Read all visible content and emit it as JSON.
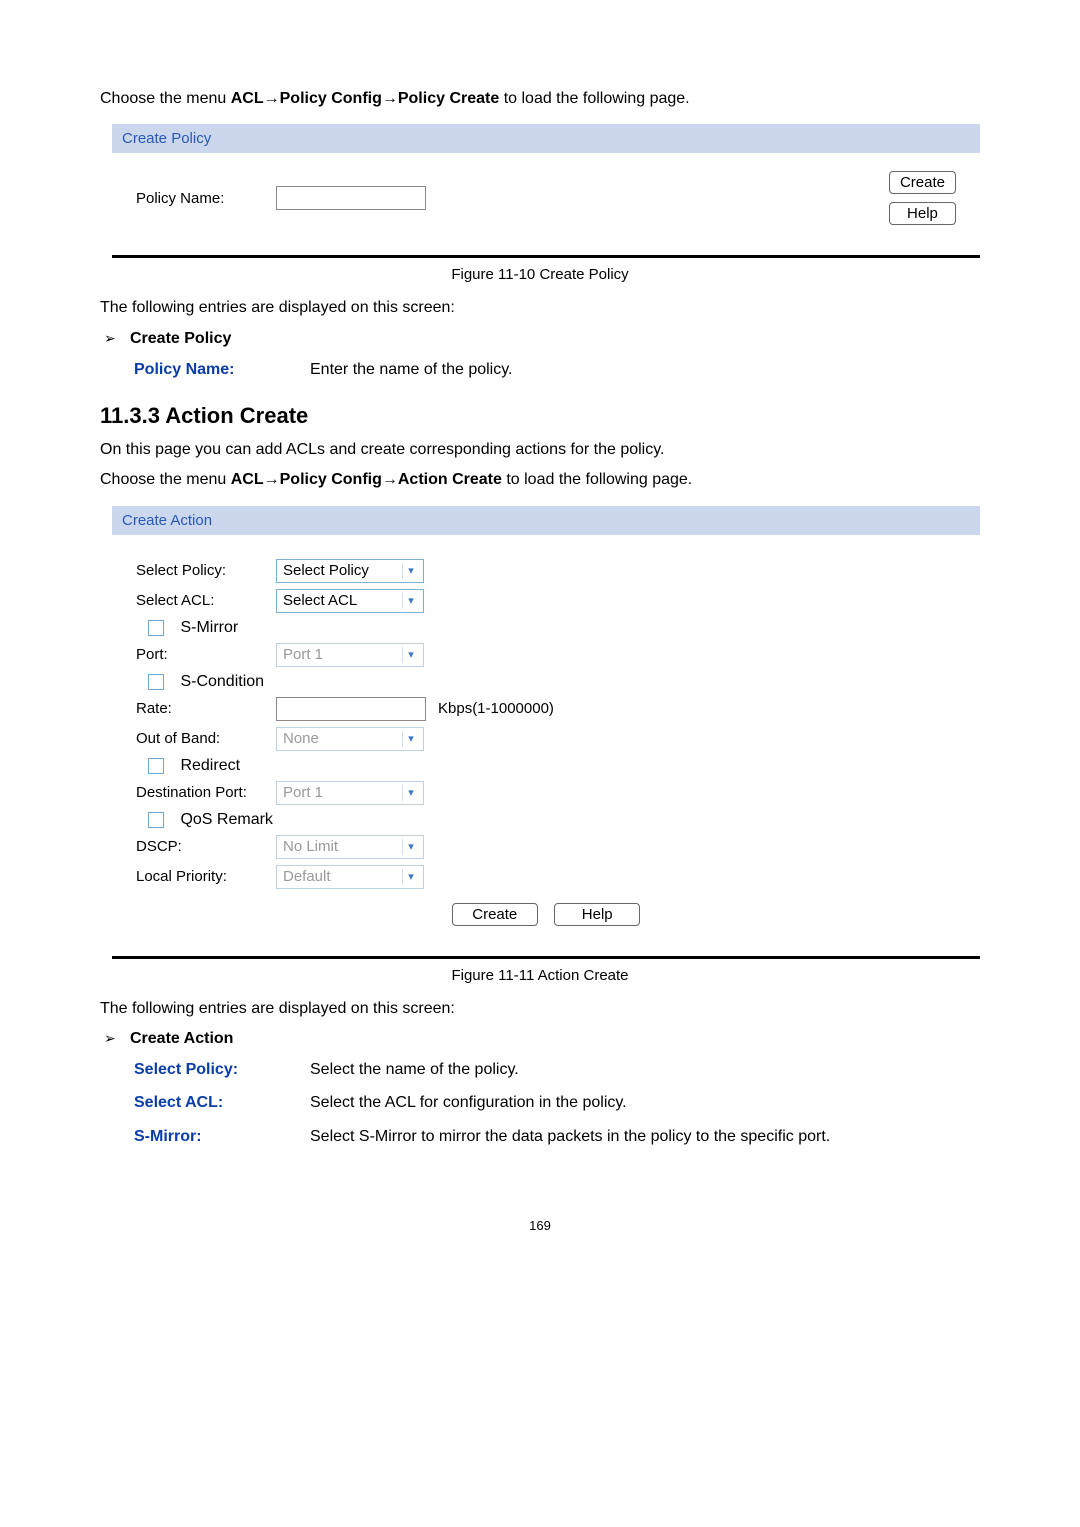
{
  "intro1_pre": "Choose the menu ",
  "intro1_path": "ACL→Policy Config→Policy Create",
  "intro1_post": " to load the following page.",
  "panel1": {
    "title": "Create Policy",
    "label": "Policy Name:",
    "btn_create": "Create",
    "btn_help": "Help"
  },
  "fig1": "Figure 11-10 Create Policy",
  "entries_text": "The following entries are displayed on this screen:",
  "bullet1": "Create Policy",
  "def1": {
    "term": "Policy Name:",
    "desc": "Enter the name of the policy."
  },
  "section_heading": "11.3.3  Action Create",
  "action_intro": "On this page you can add ACLs and create corresponding actions for the policy.",
  "intro2_pre": "Choose the menu ",
  "intro2_path": "ACL→Policy Config→Action Create",
  "intro2_post": " to load the following page.",
  "panel2": {
    "title": "Create Action",
    "select_policy_label": "Select Policy:",
    "select_policy_value": "Select Policy",
    "select_acl_label": "Select ACL:",
    "select_acl_value": "Select ACL",
    "smirror": "S-Mirror",
    "port_label": "Port:",
    "port_value": "Port 1",
    "scondition": "S-Condition",
    "rate_label": "Rate:",
    "rate_unit": "Kbps(1-1000000)",
    "oob_label": "Out of Band:",
    "oob_value": "None",
    "redirect": "Redirect",
    "dest_label": "Destination Port:",
    "dest_value": "Port 1",
    "qos": "QoS Remark",
    "dscp_label": "DSCP:",
    "dscp_value": "No Limit",
    "lp_label": "Local Priority:",
    "lp_value": "Default",
    "btn_create": "Create",
    "btn_help": "Help"
  },
  "fig2": "Figure 11-11 Action Create",
  "bullet2": "Create Action",
  "defs2": {
    "select_policy": {
      "term": "Select Policy:",
      "desc": "Select the name of the policy."
    },
    "select_acl": {
      "term": "Select ACL:",
      "desc": "Select the ACL for configuration in the policy."
    },
    "smirror": {
      "term": "S-Mirror:",
      "desc": "Select S-Mirror to mirror the data packets in the policy to the specific port."
    }
  },
  "page_number": "169"
}
